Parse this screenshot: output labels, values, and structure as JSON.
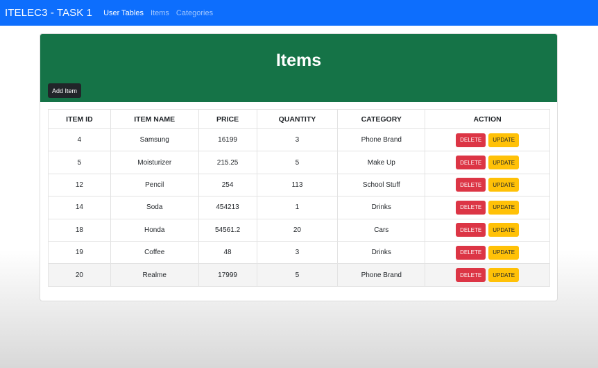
{
  "navbar": {
    "brand": "ITELEC3 - TASK 1",
    "links": [
      "User Tables",
      "Items",
      "Categories"
    ]
  },
  "header": {
    "title": "Items",
    "add_button": "Add Item"
  },
  "table": {
    "columns": [
      "ITEM ID",
      "ITEM NAME",
      "PRICE",
      "QUANTITY",
      "CATEGORY",
      "ACTION"
    ],
    "rows": [
      [
        "4",
        "Samsung",
        "16199",
        "3",
        "Phone Brand"
      ],
      [
        "5",
        "Moisturizer",
        "215.25",
        "5",
        "Make Up"
      ],
      [
        "12",
        "Pencil",
        "254",
        "113",
        "School Stuff"
      ],
      [
        "14",
        "Soda",
        "454213",
        "1",
        "Drinks"
      ],
      [
        "18",
        "Honda",
        "54561.2",
        "20",
        "Cars"
      ],
      [
        "19",
        "Coffee",
        "48",
        "3",
        "Drinks"
      ],
      [
        "20",
        "Realme",
        "17999",
        "5",
        "Phone Brand"
      ]
    ],
    "delete_label": "DELETE",
    "update_label": "UPDATE"
  },
  "colors": {
    "navbar": "#0d6efd",
    "header": "#157347",
    "delete": "#dc3545",
    "update": "#ffc107"
  }
}
